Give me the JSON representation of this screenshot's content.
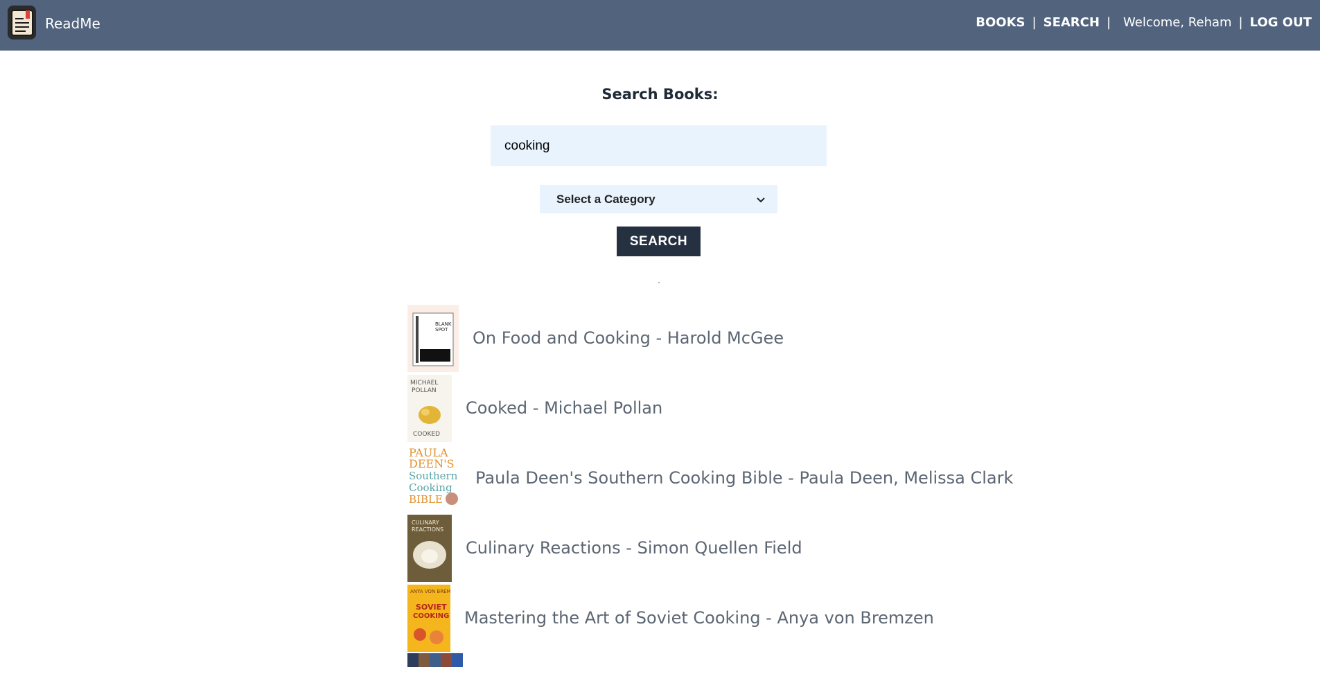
{
  "header": {
    "brand": "ReadMe",
    "nav": {
      "books": "BOOKS",
      "search": "SEARCH",
      "separator": "|",
      "welcome": "Welcome, Reham",
      "logout": "LOG OUT"
    },
    "logo_icon": "book-logo-icon"
  },
  "search": {
    "title": "Search Books:",
    "query_value": "cooking",
    "category": {
      "selected": "Select a Category"
    },
    "button_label": "SEARCH"
  },
  "results": [
    {
      "label": "On Food and Cooking - Harold McGee",
      "cover_text": "BLANK SPOT"
    },
    {
      "label": "Cooked - Michael Pollan",
      "cover_text": "MICHAEL POLLAN COOKED"
    },
    {
      "label": "Paula Deen's Southern Cooking Bible - Paula Deen, Melissa Clark",
      "cover_text": "PAULA DEEN'S Southern Cooking BIBLE"
    },
    {
      "label": "Culinary Reactions - Simon Quellen Field",
      "cover_text": "CULINARY REACTIONS"
    },
    {
      "label": "Mastering the Art of Soviet Cooking - Anya von Bremzen",
      "cover_text": "SOVIET COOKING"
    }
  ],
  "colors": {
    "header_bg": "#52637d",
    "input_bg": "#e9f3fd",
    "button_bg": "#253141",
    "result_text": "#5c6673"
  }
}
